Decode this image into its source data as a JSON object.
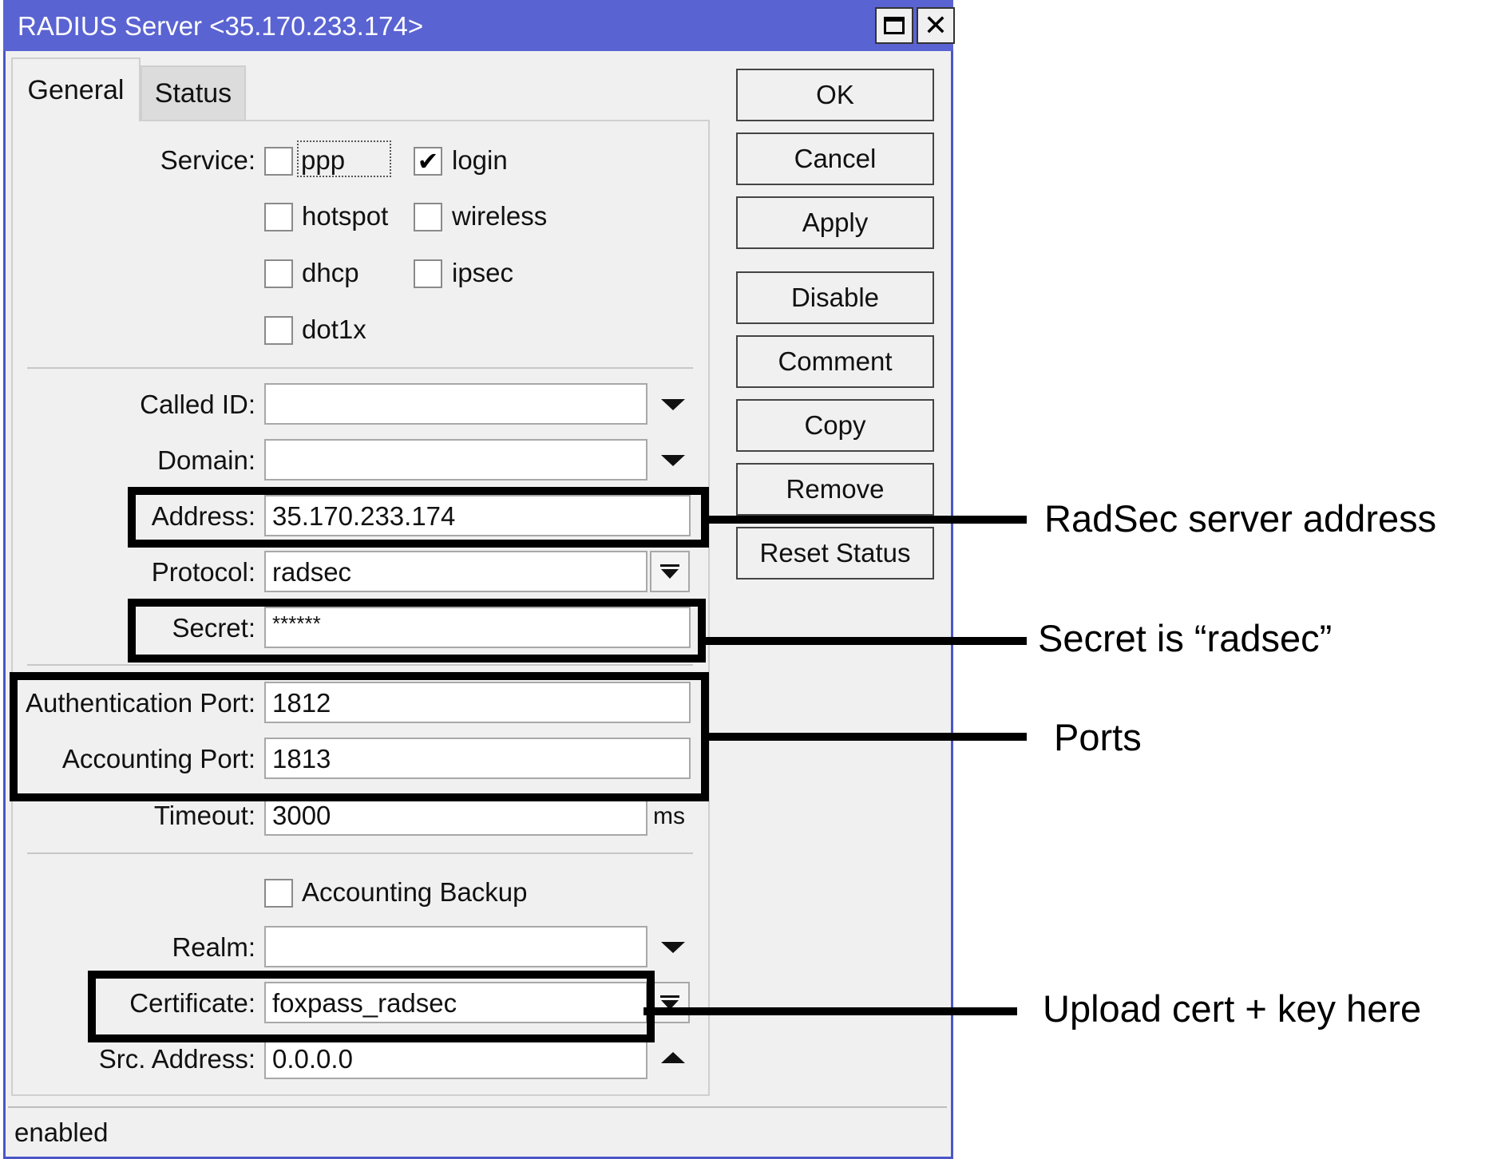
{
  "window": {
    "title": "RADIUS Server <35.170.233.174>",
    "maximize_icon": "maximize-icon",
    "close_icon": "close-icon"
  },
  "tabs": [
    {
      "label": "General",
      "active": true
    },
    {
      "label": "Status",
      "active": false
    }
  ],
  "service": {
    "label": "Service:",
    "options": [
      {
        "label": "ppp",
        "checked": false
      },
      {
        "label": "login",
        "checked": true
      },
      {
        "label": "hotspot",
        "checked": false
      },
      {
        "label": "wireless",
        "checked": false
      },
      {
        "label": "dhcp",
        "checked": false
      },
      {
        "label": "ipsec",
        "checked": false
      },
      {
        "label": "dot1x",
        "checked": false
      }
    ]
  },
  "fields": {
    "called_id": {
      "label": "Called ID:",
      "value": ""
    },
    "domain": {
      "label": "Domain:",
      "value": ""
    },
    "address": {
      "label": "Address:",
      "value": "35.170.233.174"
    },
    "protocol": {
      "label": "Protocol:",
      "value": "radsec"
    },
    "secret": {
      "label": "Secret:",
      "value": "******"
    },
    "auth_port": {
      "label": "Authentication Port:",
      "value": "1812"
    },
    "acct_port": {
      "label": "Accounting Port:",
      "value": "1813"
    },
    "timeout": {
      "label": "Timeout:",
      "value": "3000",
      "unit": "ms"
    },
    "accounting_backup": {
      "label": "Accounting Backup",
      "checked": false
    },
    "realm": {
      "label": "Realm:",
      "value": ""
    },
    "certificate": {
      "label": "Certificate:",
      "value": "foxpass_radsec"
    },
    "src_address": {
      "label": "Src. Address:",
      "value": "0.0.0.0"
    }
  },
  "buttons": {
    "ok": "OK",
    "cancel": "Cancel",
    "apply": "Apply",
    "disable": "Disable",
    "comment": "Comment",
    "copy": "Copy",
    "remove": "Remove",
    "reset_status": "Reset Status"
  },
  "status_bar": "enabled",
  "annotations": {
    "address": "RadSec server address",
    "secret": "Secret is “radsec”",
    "ports": "Ports",
    "certificate": "Upload cert + key here"
  },
  "colors": {
    "titlebar": "#5a63d2",
    "window_bg": "#f0f0f0",
    "annotation": "#000000"
  }
}
